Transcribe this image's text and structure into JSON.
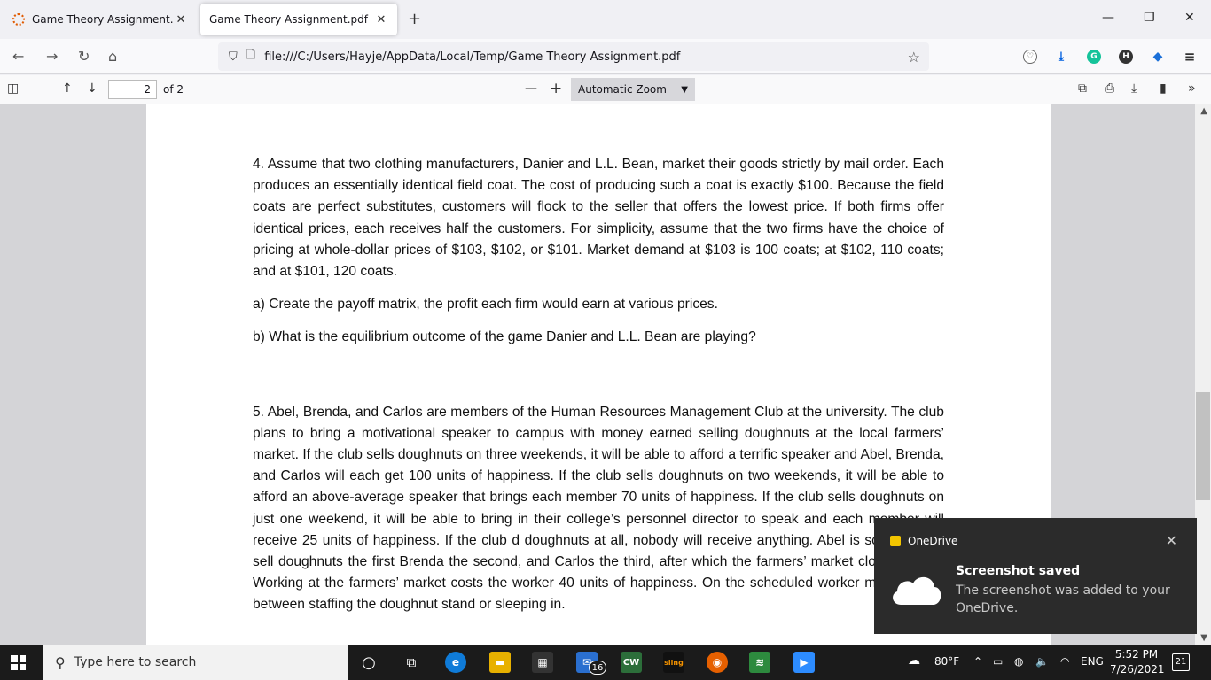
{
  "browser": {
    "tabs": [
      {
        "label": "Game Theory Assignment.pdf: |"
      },
      {
        "label": "Game Theory Assignment.pdf"
      }
    ],
    "url": "file:///C:/Users/Hayje/AppData/Local/Temp/Game Theory Assignment.pdf"
  },
  "pdf_toolbar": {
    "page_number": "2",
    "page_count": "of 2",
    "zoom": "Automatic Zoom"
  },
  "document": {
    "q4": "4.  Assume that two clothing manufacturers, Danier and L.L. Bean, market their goods strictly by mail order. Each produces an essentially identical field coat.  The cost of producing such a coat is exactly $100. Because the field coats are perfect substitutes, customers will flock to the seller that offers the lowest price.  If both firms offer identical prices, each receives half the customers.  For simplicity, assume that the two firms have the choice of pricing at whole-dollar prices of $103, $102, or $101.  Market demand at $103 is 100 coats; at $102, 110 coats; and at $101, 120 coats.",
    "q4a": "a) Create the payoff matrix, the profit each firm would earn at various prices.",
    "q4b": "b) What is the equilibrium outcome of the game Danier and L.L. Bean are playing?",
    "q5": "5. Abel, Brenda, and Carlos are members of the Human Resources Management Club at the university.  The club plans to bring a motivational speaker to campus with money earned selling doughnuts at the local farmers’ market.  If the club sells doughnuts on three weekends, it will be able to afford a terrific speaker and Abel, Brenda, and Carlos will each get 100 units of happiness.  If the club sells doughnuts on two weekends, it will be able to afford an above-average speaker that brings each member 70 units of happiness.  If the club sells doughnuts on just one weekend, it will be able to bring in their college’s personnel director to speak and each member will receive 25 units of happiness.  If the club d doughnuts at all, nobody will receive anything.  Abel is scheduled to sell doughnuts the first Brenda the second, and Carlos the third, after which the farmers’ market closes down f Working at the farmers’ market costs the worker 40 units of happiness.  On the scheduled worker must choose between staffing the doughnut stand or sleeping in."
  },
  "toast": {
    "app": "OneDrive",
    "title": "Screenshot saved",
    "message": "The screenshot was added to your OneDrive."
  },
  "taskbar": {
    "search_placeholder": "Type here to search",
    "mail_badge": "16",
    "cw_label": "CW",
    "sling_label": "sling",
    "weather": "80°F",
    "language": "ENG",
    "time": "5:52 PM",
    "date": "7/26/2021",
    "notifications": "21"
  },
  "colors": {
    "accent": "#0060df",
    "taskbar": "#1b1b1b",
    "toast_bg": "#2b2b2b"
  }
}
